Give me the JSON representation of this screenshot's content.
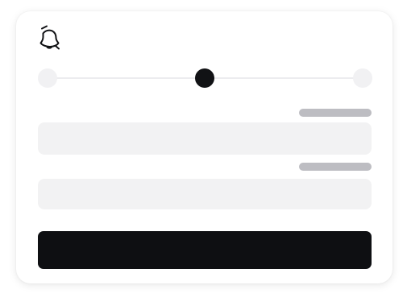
{
  "icons": {
    "header": "bell-off-icon"
  },
  "stepper": {
    "total_steps": 3,
    "current_step": 2
  },
  "form": {
    "fields": [
      {
        "label": "",
        "value": ""
      },
      {
        "label": "",
        "value": ""
      }
    ],
    "submit_label": ""
  },
  "colors": {
    "accent": "#0e0f12",
    "field_background": "#f2f2f3",
    "placeholder_bar": "#bdbdc2",
    "inactive_step": "#f1f1f3"
  }
}
